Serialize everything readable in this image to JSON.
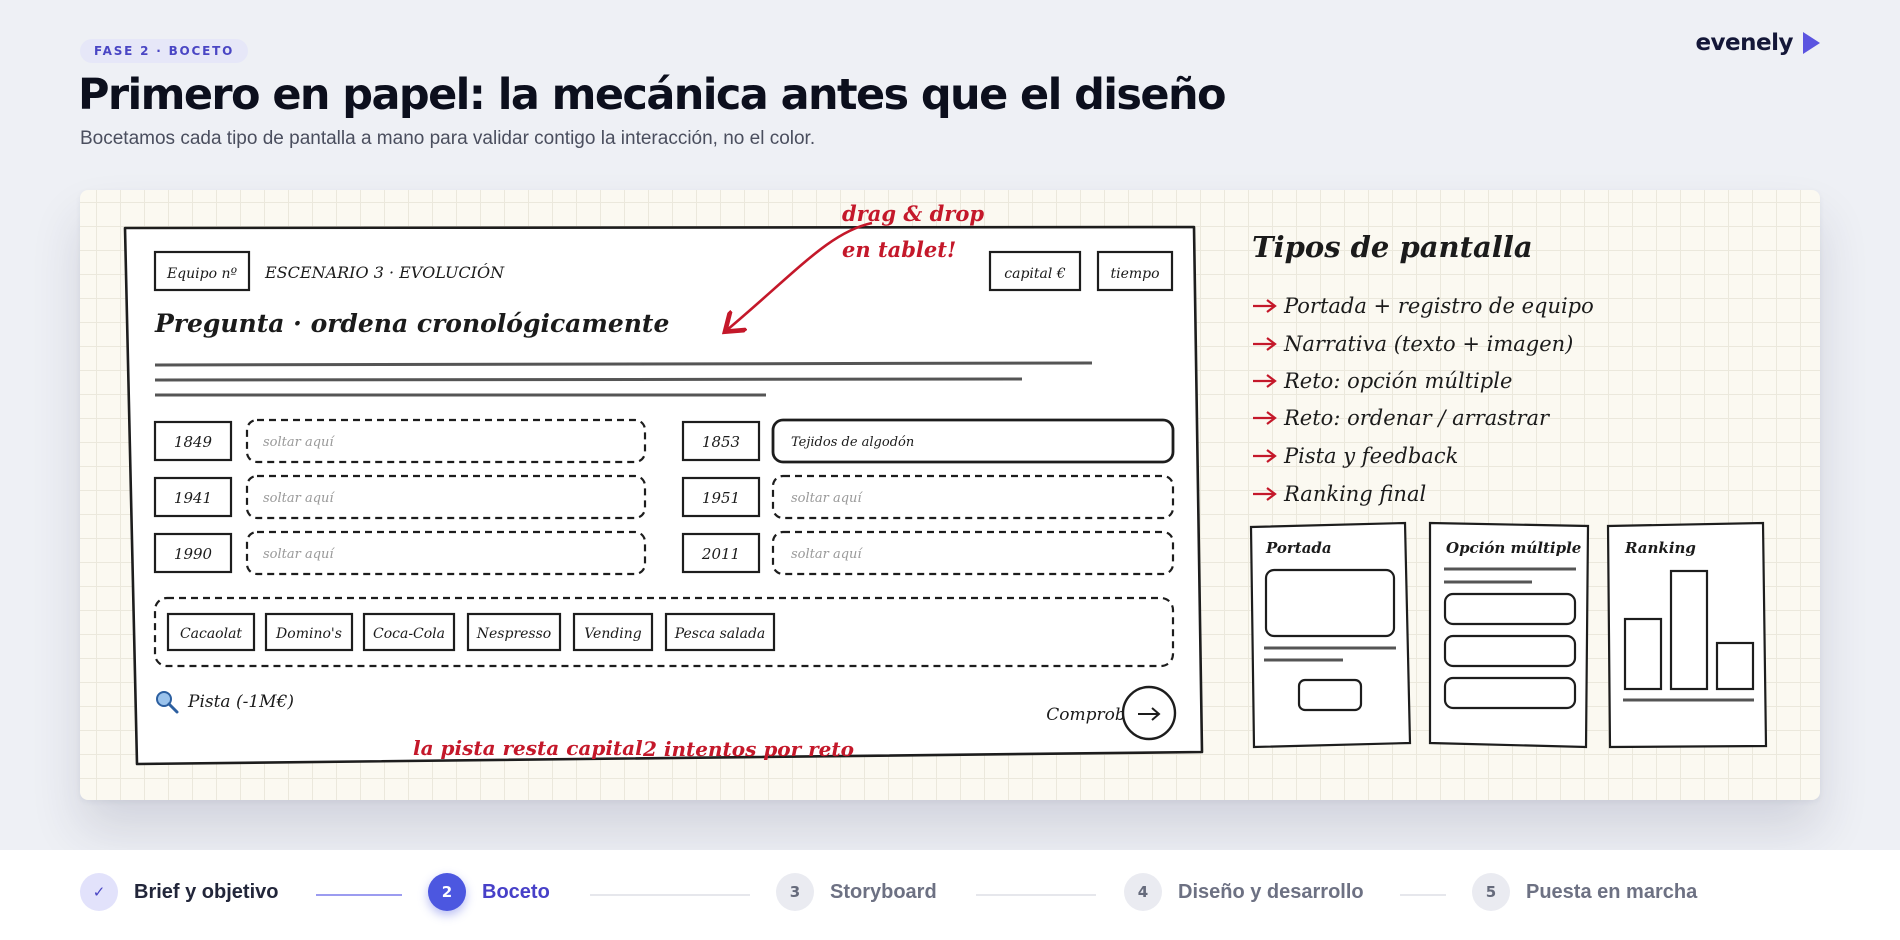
{
  "header": {
    "phase_badge": "FASE 2 · BOCETO",
    "title": "Primero en papel: la mecánica antes que el diseño",
    "subtitle": "Bocetamos cada tipo de pantalla a mano para validar contigo la interacción, no el color.",
    "logo": "evenely"
  },
  "sketch": {
    "team_label": "Equipo nº",
    "scenario": "ESCENARIO 3 · EVOLUCIÓN",
    "capital_label": "capital €",
    "time_label": "tiempo",
    "question": "Pregunta · ordena cronológicamente",
    "drop_placeholder": "soltar aquí",
    "years_left": [
      "1849",
      "1941",
      "1990"
    ],
    "years_right": [
      "1853",
      "1951",
      "2011"
    ],
    "filled_slot": "Tejidos de algodón",
    "chips": [
      "Cacaolat",
      "Domino's",
      "Coca-Cola",
      "Nespresso",
      "Vending",
      "Pesca salada"
    ],
    "hint": "Pista (-1M€)",
    "check": "Comprobar",
    "note_drag_1": "drag & drop",
    "note_drag_2": "en tablet!",
    "note_hint": "la pista resta capital",
    "note_attempts": "2 intentos por reto"
  },
  "screen_types": {
    "title": "Tipos de pantalla",
    "items": [
      "Portada + registro de equipo",
      "Narrativa (texto + imagen)",
      "Reto: opción múltiple",
      "Reto: ordenar / arrastrar",
      "Pista y feedback",
      "Ranking final"
    ],
    "thumbs": [
      "Portada",
      "Opción múltiple",
      "Ranking"
    ]
  },
  "stepper": {
    "steps": [
      {
        "num": "✓",
        "label": "Brief y objetivo"
      },
      {
        "num": "2",
        "label": "Boceto"
      },
      {
        "num": "3",
        "label": "Storyboard"
      },
      {
        "num": "4",
        "label": "Diseño y desarrollo"
      },
      {
        "num": "5",
        "label": "Puesta en marcha"
      }
    ]
  },
  "colors": {
    "accent": "#4c57e0",
    "annotation_red": "#c4182a",
    "paper": "#fbf9f1"
  }
}
